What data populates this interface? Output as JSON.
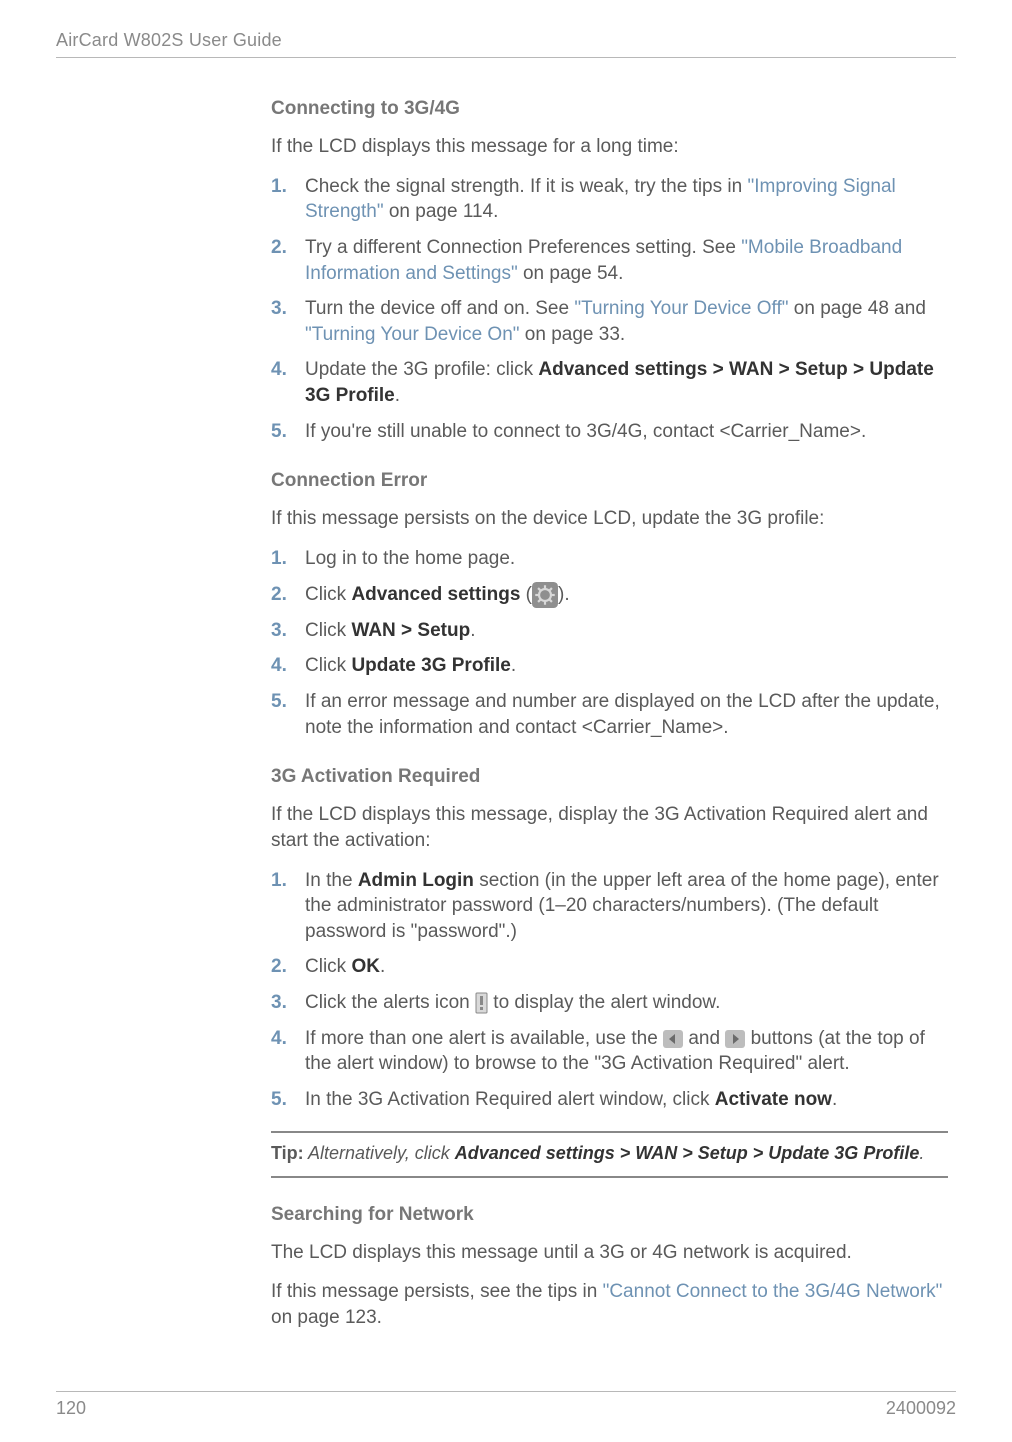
{
  "running_head": "AirCard W802S User Guide",
  "footer": {
    "page": "120",
    "docnum": "2400092"
  },
  "sec1": {
    "title": "Connecting to 3G/4G",
    "intro": "If the LCD displays this message for a long time:",
    "steps": [
      {
        "n": "1.",
        "pre": "Check the signal strength. If it is weak, try the tips in ",
        "link": "\"Improving Signal Strength\"",
        "post": " on page 114."
      },
      {
        "n": "2.",
        "pre": "Try a different Connection Preferences setting. See ",
        "link": "\"Mobile Broadband Information and Settings\"",
        "post": " on page 54."
      },
      {
        "n": "3.",
        "pre": "Turn the device off and on. See ",
        "link1": "\"Turning Your Device Off\"",
        "mid": " on page 48 and ",
        "link2": "\"Turning Your Device On\"",
        "post": " on page 33."
      },
      {
        "n": "4.",
        "pre": "Update the 3G profile: click ",
        "bold": "Advanced settings > WAN > Setup > Update 3G Profile",
        "post": "."
      },
      {
        "n": "5.",
        "text": "If you're still unable to connect to 3G/4G, contact <Carrier_Name>."
      }
    ]
  },
  "sec2": {
    "title": "Connection Error",
    "intro": "If this message persists on the device LCD, update the 3G profile:",
    "steps": [
      {
        "n": "1.",
        "text": "Log in to the home page."
      },
      {
        "n": "2.",
        "pre": "Click ",
        "bold": "Advanced settings",
        "post_open": " (",
        "post_close": ")."
      },
      {
        "n": "3.",
        "pre": "Click ",
        "bold": "WAN > Setup",
        "post": "."
      },
      {
        "n": "4.",
        "pre": "Click ",
        "bold": "Update 3G Profile",
        "post": "."
      },
      {
        "n": "5.",
        "text": "If an error message and number are displayed on the LCD after the update, note the information and contact <Carrier_Name>."
      }
    ]
  },
  "sec3": {
    "title": "3G Activation Required",
    "intro": "If the LCD displays this message, display the 3G Activation Required alert and start the activation:",
    "steps": [
      {
        "n": "1.",
        "pre": "In the ",
        "bold": "Admin Login",
        "post": " section (in the upper left area of the home page), enter the administrator password (1–20 characters/numbers). (The default password is \"password\".)"
      },
      {
        "n": "2.",
        "pre": "Click ",
        "bold": "OK",
        "post": "."
      },
      {
        "n": "3.",
        "pre": "Click the alerts icon ",
        "post": " to display the alert window."
      },
      {
        "n": "4.",
        "pre": "If more than one alert is available, use the ",
        "mid": " and ",
        "post": " buttons (at the top of the alert window) to browse to the \"3G Activation Required\" alert."
      },
      {
        "n": "5.",
        "pre": "In the 3G Activation Required alert window, click ",
        "bold": "Activate now",
        "post": "."
      }
    ]
  },
  "tip": {
    "label": "Tip:",
    "italic_pre": "  Alternatively, click ",
    "bold": "Advanced settings > WAN > Setup > Update 3G Profile",
    "post": "."
  },
  "sec4": {
    "title": "Searching for Network",
    "p1": "The LCD displays this message until a 3G or 4G network is acquired.",
    "p2_pre": "If this message persists, see the tips in ",
    "p2_link": "\"Cannot Connect to the 3G/4G Network\"",
    "p2_post": " on page 123."
  }
}
